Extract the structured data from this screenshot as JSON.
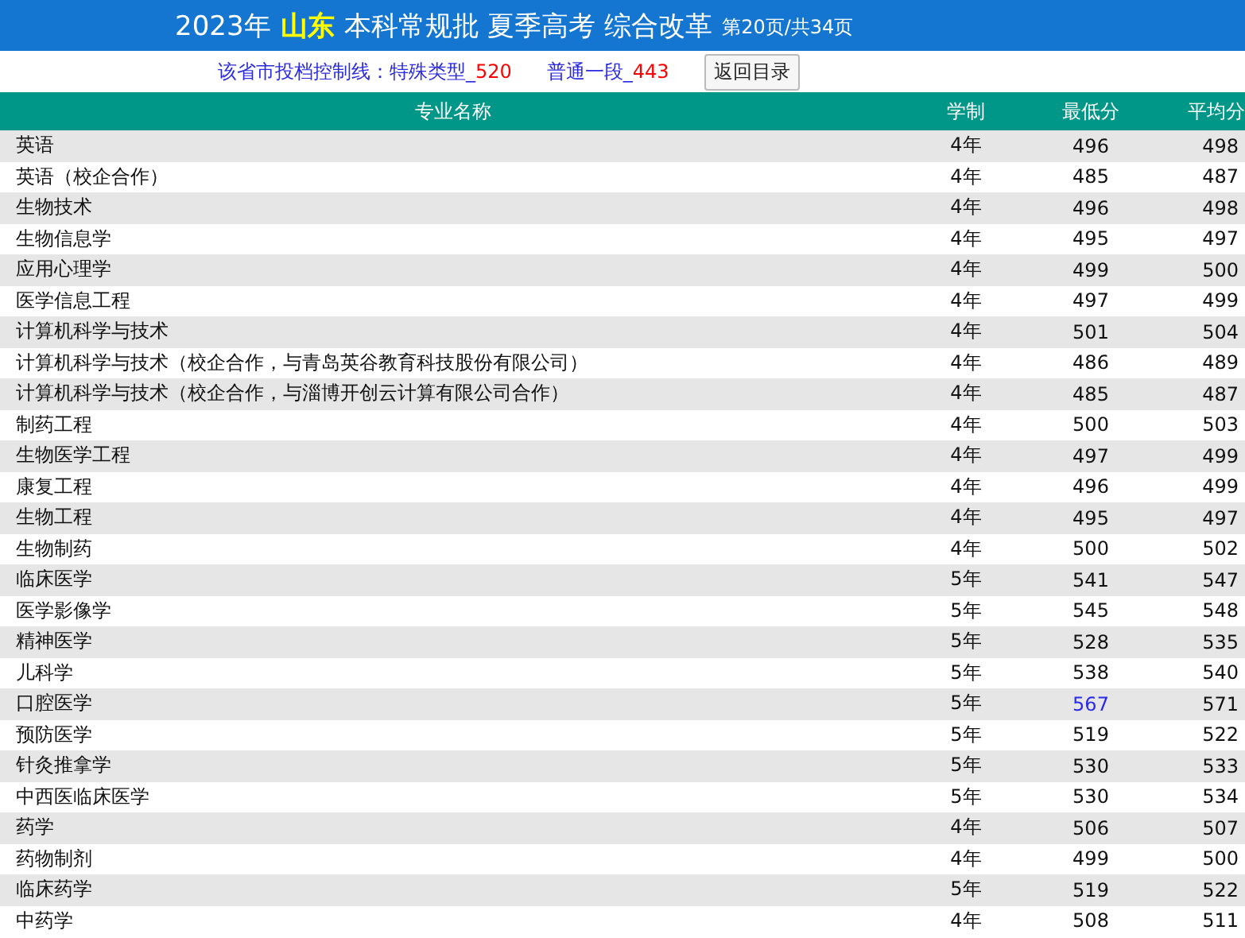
{
  "header": {
    "year": "2023年",
    "province": "山东",
    "title": "本科常规批 夏季高考 综合改革",
    "page_info": "第20页/共34页"
  },
  "control_lines": {
    "label": "该省市投档控制线：",
    "items": [
      {
        "name": "特殊类型_",
        "value": "520"
      },
      {
        "name": "普通一段_",
        "value": "443"
      }
    ],
    "button": "返回目录"
  },
  "table": {
    "columns": [
      "专业名称",
      "学制",
      "最低分",
      "平均分"
    ],
    "rows": [
      {
        "name": "英语",
        "years": "4年",
        "min": "496",
        "avg": "498",
        "highlighted": false
      },
      {
        "name": "英语（校企合作）",
        "years": "4年",
        "min": "485",
        "avg": "487",
        "highlighted": false
      },
      {
        "name": "生物技术",
        "years": "4年",
        "min": "496",
        "avg": "498",
        "highlighted": false
      },
      {
        "name": "生物信息学",
        "years": "4年",
        "min": "495",
        "avg": "497",
        "highlighted": false
      },
      {
        "name": "应用心理学",
        "years": "4年",
        "min": "499",
        "avg": "500",
        "highlighted": false
      },
      {
        "name": "医学信息工程",
        "years": "4年",
        "min": "497",
        "avg": "499",
        "highlighted": false
      },
      {
        "name": "计算机科学与技术",
        "years": "4年",
        "min": "501",
        "avg": "504",
        "highlighted": false
      },
      {
        "name": "计算机科学与技术（校企合作，与青岛英谷教育科技股份有限公司）",
        "years": "4年",
        "min": "486",
        "avg": "489",
        "highlighted": false
      },
      {
        "name": "计算机科学与技术（校企合作，与淄博开创云计算有限公司合作）",
        "years": "4年",
        "min": "485",
        "avg": "487",
        "highlighted": false
      },
      {
        "name": "制药工程",
        "years": "4年",
        "min": "500",
        "avg": "503",
        "highlighted": false
      },
      {
        "name": "生物医学工程",
        "years": "4年",
        "min": "497",
        "avg": "499",
        "highlighted": false
      },
      {
        "name": "康复工程",
        "years": "4年",
        "min": "496",
        "avg": "499",
        "highlighted": false
      },
      {
        "name": "生物工程",
        "years": "4年",
        "min": "495",
        "avg": "497",
        "highlighted": false
      },
      {
        "name": "生物制药",
        "years": "4年",
        "min": "500",
        "avg": "502",
        "highlighted": false
      },
      {
        "name": "临床医学",
        "years": "5年",
        "min": "541",
        "avg": "547",
        "highlighted": false
      },
      {
        "name": "医学影像学",
        "years": "5年",
        "min": "545",
        "avg": "548",
        "highlighted": false
      },
      {
        "name": "精神医学",
        "years": "5年",
        "min": "528",
        "avg": "535",
        "highlighted": false
      },
      {
        "name": "儿科学",
        "years": "5年",
        "min": "538",
        "avg": "540",
        "highlighted": false
      },
      {
        "name": "口腔医学",
        "years": "5年",
        "min": "567",
        "avg": "571",
        "highlighted": true
      },
      {
        "name": "预防医学",
        "years": "5年",
        "min": "519",
        "avg": "522",
        "highlighted": false
      },
      {
        "name": "针灸推拿学",
        "years": "5年",
        "min": "530",
        "avg": "533",
        "highlighted": false
      },
      {
        "name": "中西医临床医学",
        "years": "5年",
        "min": "530",
        "avg": "534",
        "highlighted": false
      },
      {
        "name": "药学",
        "years": "4年",
        "min": "506",
        "avg": "507",
        "highlighted": false
      },
      {
        "name": "药物制剂",
        "years": "4年",
        "min": "499",
        "avg": "500",
        "highlighted": false
      },
      {
        "name": "临床药学",
        "years": "5年",
        "min": "519",
        "avg": "522",
        "highlighted": false
      },
      {
        "name": "中药学",
        "years": "4年",
        "min": "508",
        "avg": "511",
        "highlighted": false
      }
    ]
  }
}
